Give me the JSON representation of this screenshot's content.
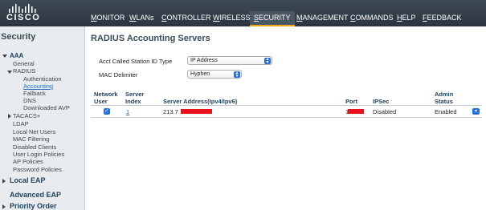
{
  "header": {
    "logo_text": "CISCO",
    "nav": [
      {
        "label": "MONITOR",
        "u": "M",
        "rest": "ONITOR"
      },
      {
        "label": "WLANs",
        "u": "W",
        "rest": "LANs"
      },
      {
        "label": "CONTROLLER",
        "u": "C",
        "rest": "ONTROLLER"
      },
      {
        "label": "WIRELESS",
        "u": "W",
        "rest": "IRELESS"
      },
      {
        "label": "SECURITY",
        "u": "S",
        "rest": "ECURITY"
      },
      {
        "label": "MANAGEMENT",
        "u": "M",
        "rest": "ANAGEMENT"
      },
      {
        "label": "COMMANDS",
        "u": "C",
        "rest": "OMMANDS"
      },
      {
        "label": "HELP",
        "u": "H",
        "rest": "ELP"
      },
      {
        "label": "FEEDBACK",
        "u": "F",
        "rest": "EEDBACK"
      }
    ],
    "active_color": "#f3a21b"
  },
  "sidebar": {
    "title": "Security",
    "aaa": "AAA",
    "general": "General",
    "radius": "RADIUS",
    "authentication": "Authentication",
    "accounting": "Accounting",
    "fallback": "Fallback",
    "dns": "DNS",
    "downloaded_avp": "Downloaded AVP",
    "tacacs": "TACACS+",
    "ldap": "LDAP",
    "local_net_users": "Local Net Users",
    "mac_filtering": "MAC Filtering",
    "disabled_clients": "Disabled Clients",
    "user_login_policies": "User Login Policies",
    "ap_policies": "AP Policies",
    "password_policies": "Password Policies",
    "local_eap": "Local EAP",
    "advanced_eap": "Advanced EAP",
    "priority_order": "Priority Order"
  },
  "main": {
    "title": "RADIUS Accounting Servers",
    "acct_label": "Acct Called Station ID Type",
    "acct_value": "IP Address",
    "mac_label": "MAC Delimiter",
    "mac_value": "Hyphen",
    "columns": {
      "network_user_1": "Network",
      "network_user_2": "User",
      "server_index_1": "Server",
      "server_index_2": "Index",
      "server_address": "Server Address(Ipv4/Ipv6)",
      "port": "Port",
      "ipsec": "IPSec",
      "admin_status_1": "Admin",
      "admin_status_2": "Status"
    },
    "row": {
      "index": "1",
      "address_visible": "213.7",
      "port_visible": "1",
      "ipsec": "Disabled",
      "admin_status": "Enabled"
    }
  }
}
